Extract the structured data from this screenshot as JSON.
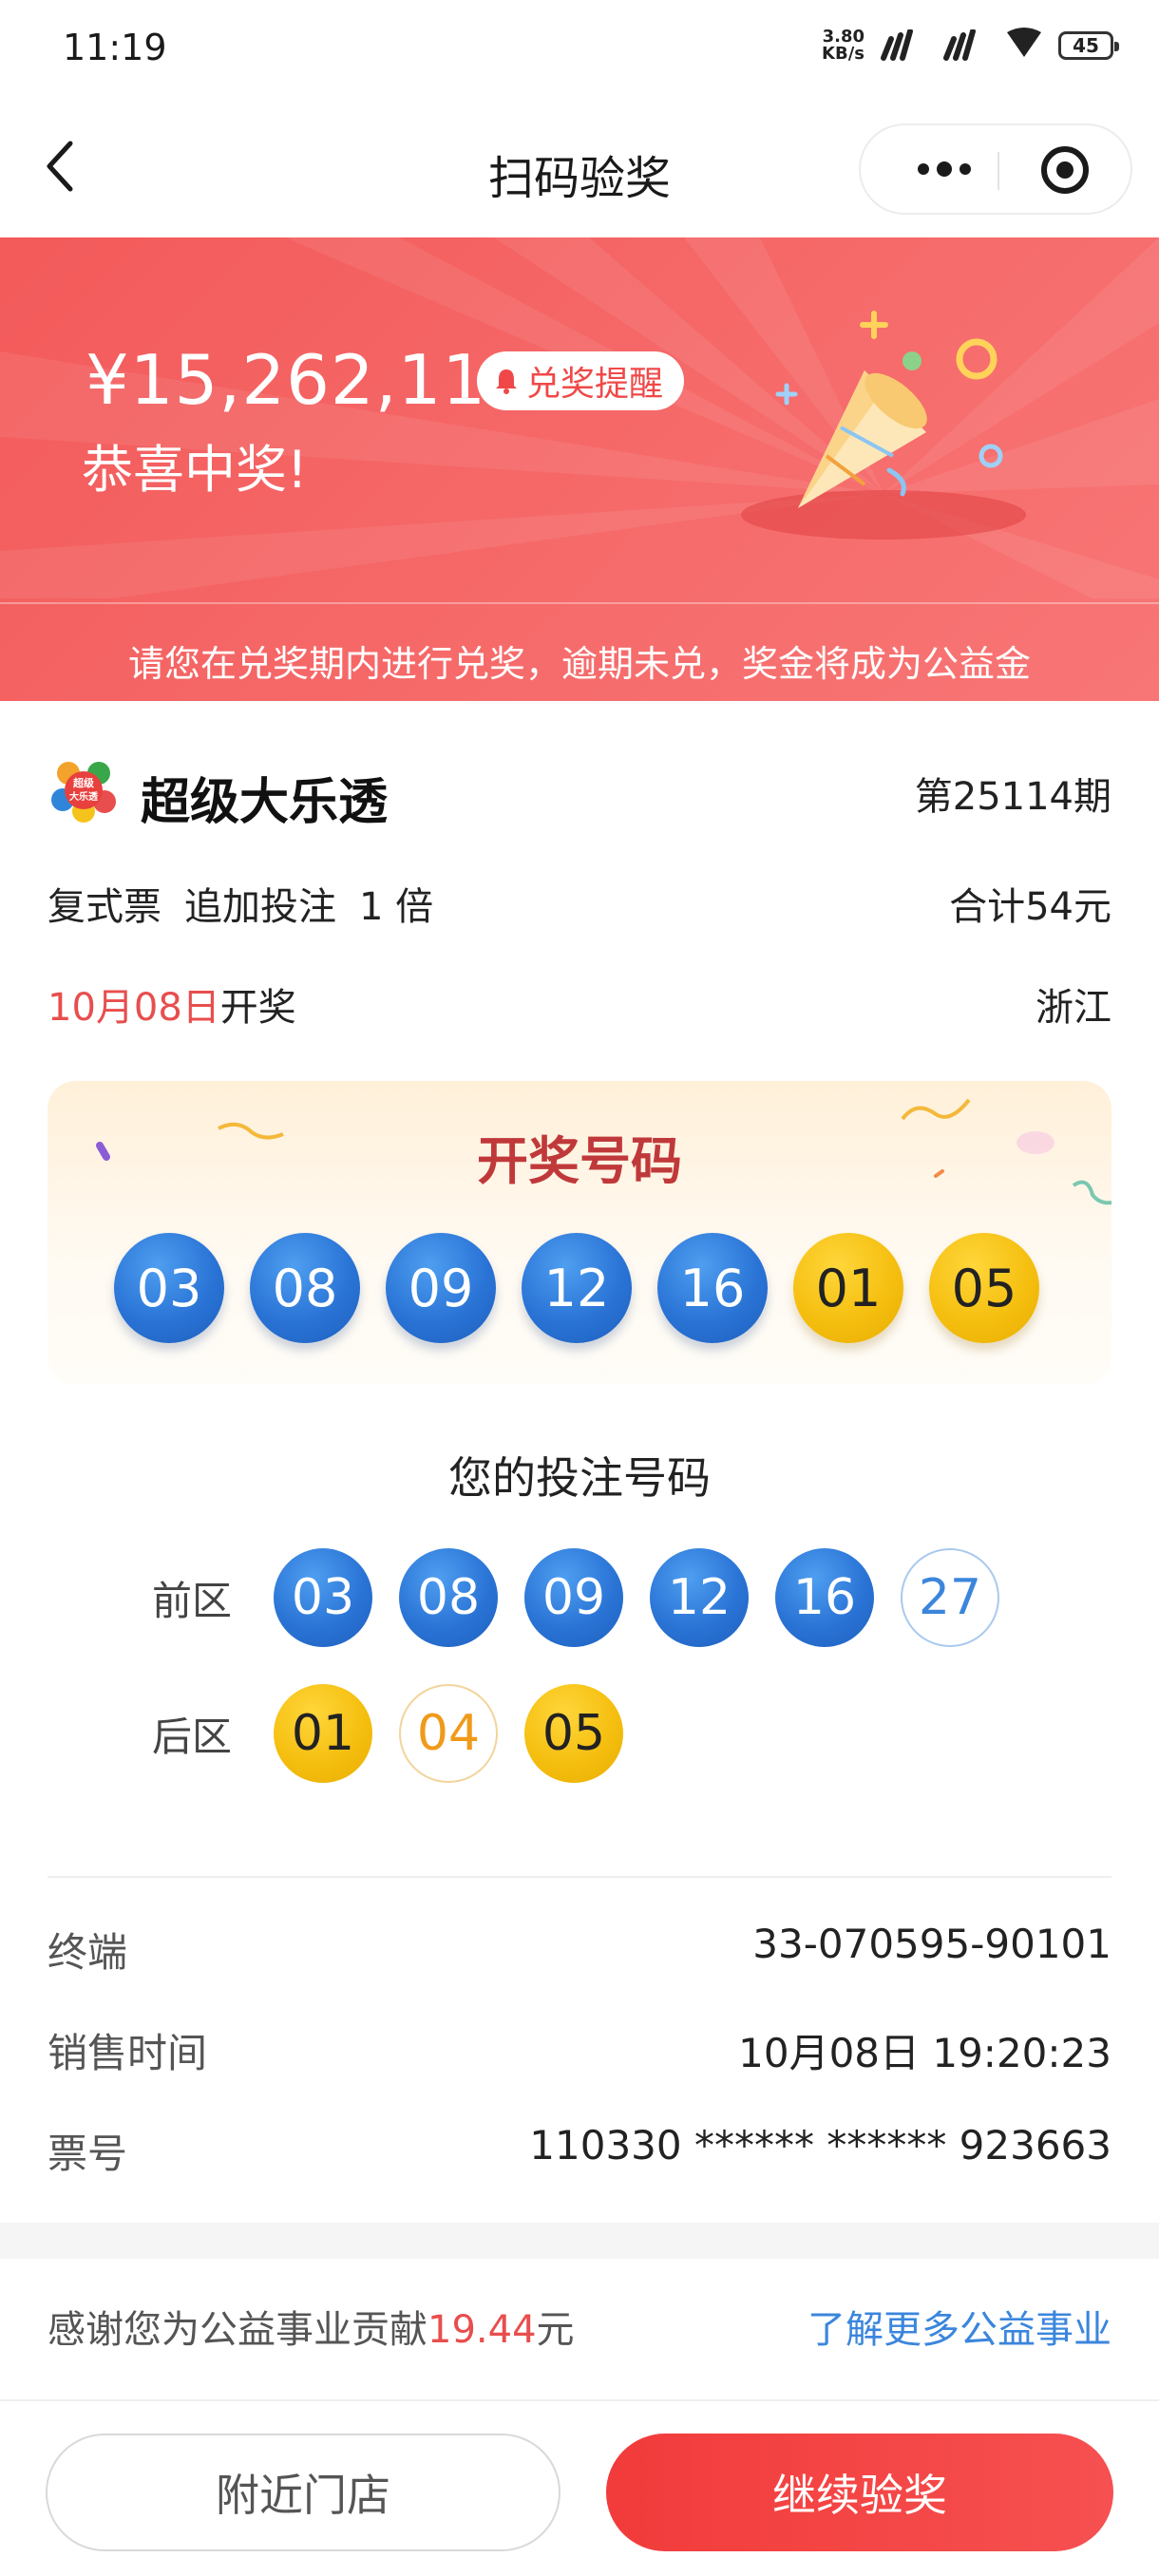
{
  "status_bar": {
    "time": "11:19",
    "net_speed_top": "3.80",
    "net_speed_bottom": "KB/s",
    "network_tag": "5G",
    "battery": "45"
  },
  "nav": {
    "title": "扫码验奖"
  },
  "banner": {
    "prize_amount": "¥15,262,115",
    "remind_label": "兑奖提醒",
    "congrats": "恭喜中奖!",
    "notice": "请您在兑奖期内进行兑奖，逾期未兑，奖金将成为公益金"
  },
  "ticket": {
    "game_name": "超级大乐透",
    "logo_text": "超级大乐透",
    "issue": "第25114期",
    "ticket_type": "复式票",
    "addon": "追加投注",
    "multiple": "1 倍",
    "total": "合计54元",
    "draw_date": "10月08日",
    "draw_suffix": "开奖",
    "province": "浙江"
  },
  "draw": {
    "title": "开奖号码",
    "front": [
      "03",
      "08",
      "09",
      "12",
      "16"
    ],
    "back": [
      "01",
      "05"
    ]
  },
  "bet": {
    "title": "您的投注号码",
    "front_label": "前区",
    "back_label": "后区",
    "front": [
      {
        "num": "03",
        "hit": true
      },
      {
        "num": "08",
        "hit": true
      },
      {
        "num": "09",
        "hit": true
      },
      {
        "num": "12",
        "hit": true
      },
      {
        "num": "16",
        "hit": true
      },
      {
        "num": "27",
        "hit": false
      }
    ],
    "back": [
      {
        "num": "01",
        "hit": true
      },
      {
        "num": "04",
        "hit": false
      },
      {
        "num": "05",
        "hit": true
      }
    ]
  },
  "details": {
    "terminal_label": "终端",
    "terminal_value": "33-070595-90101",
    "sale_time_label": "销售时间",
    "sale_time_value": "10月08日 19:20:23",
    "ticket_no_label": "票号",
    "ticket_no_value": "110330 ****** ****** 923663"
  },
  "charity": {
    "prefix": "感谢您为公益事业贡献",
    "amount": "19.44",
    "suffix": "元",
    "link": "了解更多公益事业"
  },
  "actions": {
    "nearby": "附近门店",
    "continue": "继续验奖"
  },
  "colors": {
    "banner_red": "#f35a5a",
    "primary_red": "#f23b3b",
    "blue_ball": "#2a74d6",
    "yellow_ball": "#f5bf10",
    "link_blue": "#3b86dc"
  }
}
